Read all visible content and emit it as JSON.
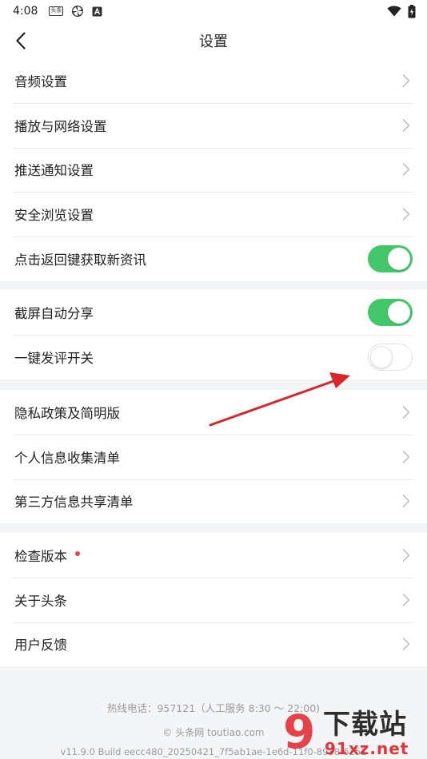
{
  "status_bar": {
    "time": "4:08",
    "left_badge_text": "头条",
    "left_icons": [
      "app-badge-icon",
      "pinwheel-icon",
      "a-letter-icon"
    ],
    "right_icons": [
      "wifi-icon",
      "battery-charging-icon"
    ]
  },
  "header": {
    "title": "设置",
    "back_icon": "chevron-left-icon"
  },
  "groups": [
    {
      "items": [
        {
          "label": "音频设置",
          "control": "chevron"
        },
        {
          "label": "播放与网络设置",
          "control": "chevron"
        },
        {
          "label": "推送通知设置",
          "control": "chevron"
        },
        {
          "label": "安全浏览设置",
          "control": "chevron"
        },
        {
          "label": "点击返回键获取新资讯",
          "control": "toggle",
          "on": true
        }
      ]
    },
    {
      "items": [
        {
          "label": "截屏自动分享",
          "control": "toggle",
          "on": true
        },
        {
          "label": "一键发评开关",
          "control": "toggle",
          "on": false
        }
      ]
    },
    {
      "items": [
        {
          "label": "隐私政策及简明版",
          "control": "chevron"
        },
        {
          "label": "个人信息收集清单",
          "control": "chevron"
        },
        {
          "label": "第三方信息共享清单",
          "control": "chevron"
        }
      ]
    },
    {
      "items": [
        {
          "label": "检查版本",
          "control": "chevron",
          "red_dot": true
        },
        {
          "label": "关于头条",
          "control": "chevron"
        },
        {
          "label": "用户反馈",
          "control": "chevron"
        }
      ]
    }
  ],
  "footer": {
    "hotline": "热线电话：957121（人工服务 8:30 ～ 22:00)",
    "site": "© 头条网 toutiao.com",
    "build": "v11.9.0 Build eecc480_20250421_7f5ab1ae-1e6d-11f0-8938-6251"
  },
  "watermark": {
    "logo_mark": "9",
    "title": "下载站",
    "url": "91xz.net"
  },
  "colors": {
    "toggle_on": "#42c868",
    "red_dot": "#f04142",
    "annotation_arrow": "#d8262c"
  }
}
